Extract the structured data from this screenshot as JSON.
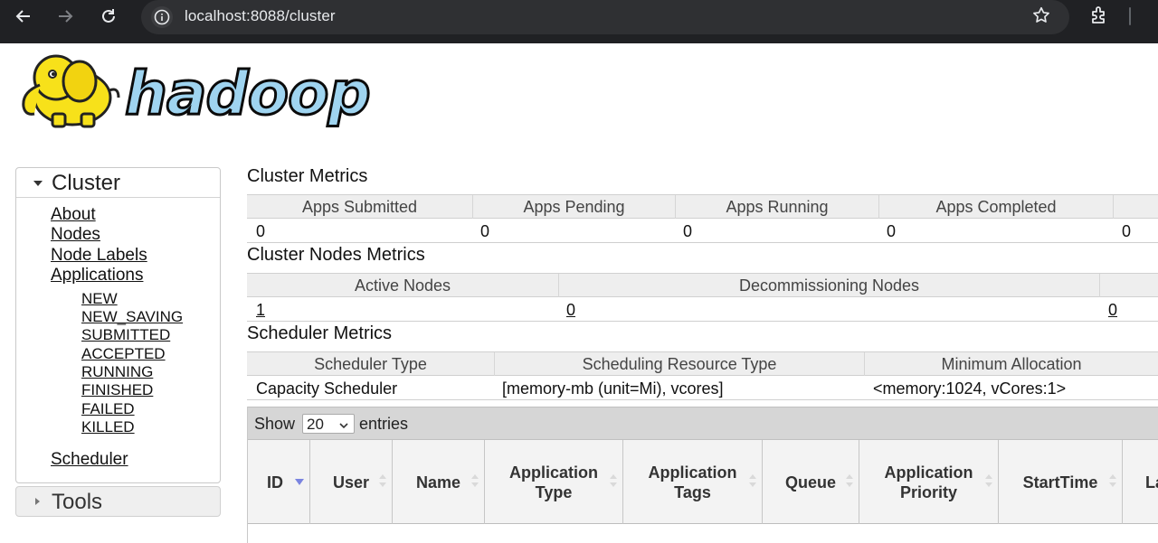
{
  "browser": {
    "url": "localhost:8088/cluster",
    "icons": [
      "back-icon",
      "forward-icon",
      "reload-icon",
      "info-icon",
      "star-icon",
      "extensions-icon"
    ]
  },
  "logo": {
    "text": "hadoop"
  },
  "sidebar": {
    "cluster_title": "Cluster",
    "items": [
      {
        "label": "About"
      },
      {
        "label": "Nodes"
      },
      {
        "label": "Node Labels"
      },
      {
        "label": "Applications"
      }
    ],
    "app_states": [
      "NEW",
      "NEW_SAVING",
      "SUBMITTED",
      "ACCEPTED",
      "RUNNING",
      "FINISHED",
      "FAILED",
      "KILLED"
    ],
    "scheduler_label": "Scheduler",
    "tools_title": "Tools"
  },
  "cluster_metrics": {
    "title": "Cluster Metrics",
    "headers": [
      "Apps Submitted",
      "Apps Pending",
      "Apps Running",
      "Apps Completed"
    ],
    "values": [
      "0",
      "0",
      "0",
      "0",
      "0"
    ]
  },
  "nodes_metrics": {
    "title": "Cluster Nodes Metrics",
    "headers": [
      "Active Nodes",
      "Decommissioning Nodes"
    ],
    "values": [
      "1",
      "0",
      "0"
    ]
  },
  "scheduler_metrics": {
    "title": "Scheduler Metrics",
    "headers": [
      "Scheduler Type",
      "Scheduling Resource Type",
      "Minimum Allocation"
    ],
    "values": [
      "Capacity Scheduler",
      "[memory-mb (unit=Mi), vcores]",
      "<memory:1024, vCores:1>"
    ]
  },
  "apps_table": {
    "show_label": "Show",
    "page_size": "20",
    "entries_label": "entries",
    "columns": [
      "ID",
      "User",
      "Name",
      "Application Type",
      "Application Tags",
      "Queue",
      "Application Priority",
      "StartTime",
      "La"
    ]
  }
}
